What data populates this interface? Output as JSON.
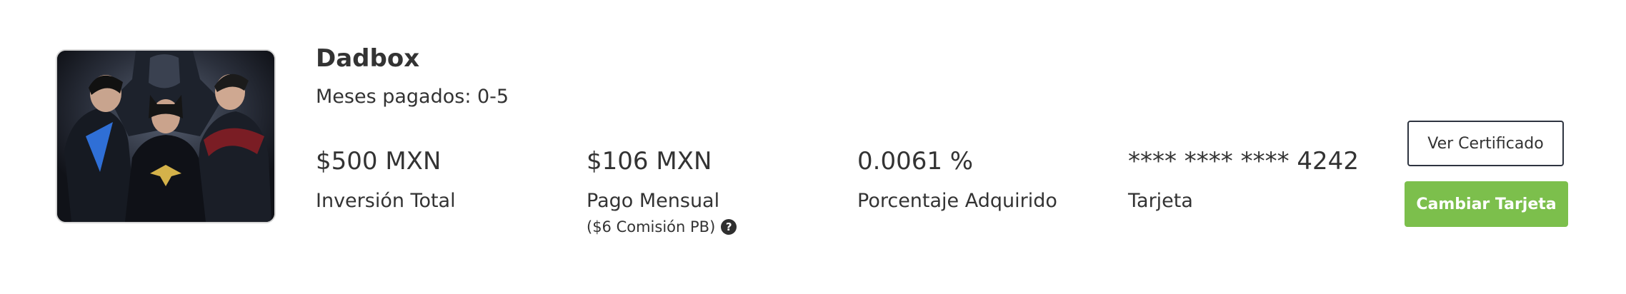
{
  "product": {
    "name": "Dadbox",
    "months_paid": "Meses pagados: 0-5"
  },
  "stats": [
    {
      "value": "$500 MXN",
      "label": "Inversión Total"
    },
    {
      "value": "$106 MXN",
      "label": "Pago Mensual",
      "note": "($6 Comisión PB)"
    },
    {
      "value": "0.0061 %",
      "label": "Porcentaje Adquirido"
    },
    {
      "value": "**** **** **** 4242",
      "label": "Tarjeta"
    }
  ],
  "help_icon": {
    "name": "question-circle-icon",
    "glyph": "?"
  },
  "actions": {
    "certificate_label": "Ver Certificado",
    "change_card_label": "Cambiar Tarjeta"
  },
  "colors": {
    "primary_green": "#7cbf4c",
    "outline_border": "#2e3440",
    "text": "#333333"
  }
}
